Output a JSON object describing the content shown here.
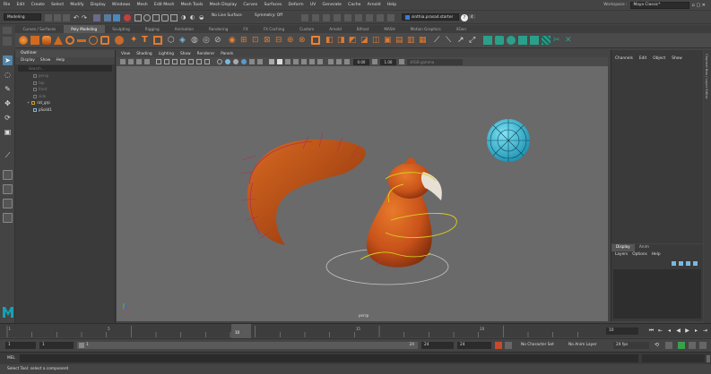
{
  "menubar": {
    "items": [
      "File",
      "Edit",
      "Create",
      "Select",
      "Modify",
      "Display",
      "Windows",
      "Mesh",
      "Edit Mesh",
      "Mesh Tools",
      "Mesh Display",
      "Curves",
      "Surfaces",
      "Deform",
      "UV",
      "Generate",
      "Cache",
      "Arnold",
      "Help"
    ],
    "workspace_label": "Workspace :",
    "workspace_value": "Maya Classic*"
  },
  "statusline": {
    "mode_menu": "Modeling",
    "live_surface": "No Live Surface",
    "symmetry": "Symmetry: Off",
    "user": "sinthia.prasad.starter",
    "user_badge": "4"
  },
  "shelf": {
    "tabs": [
      "Curves / Surfaces",
      "Poly Modeling",
      "Sculpting",
      "Rigging",
      "Animation",
      "Rendering",
      "FX",
      "FX Caching",
      "Custom",
      "Arnold",
      "Bifrost",
      "MASH",
      "Motion Graphics",
      "XGen"
    ],
    "active_tab": "Poly Modeling"
  },
  "outliner": {
    "title": "Outliner",
    "menu": [
      "Display",
      "Show",
      "Help"
    ],
    "search_placeholder": "Search...",
    "hidden_items": [
      "persp",
      "top",
      "front",
      "side"
    ],
    "items": [
      "rat_grp",
      "pSolid1"
    ]
  },
  "viewport": {
    "panel_menu": [
      "View",
      "Shading",
      "Lighting",
      "Show",
      "Renderer",
      "Panels"
    ],
    "field_a": "0.00",
    "field_b": "1.00",
    "colorspace": "sRGB gamma",
    "camera_label": "persp"
  },
  "channelbox": {
    "menu": [
      "Channels",
      "Edit",
      "Object",
      "Show"
    ],
    "sidetab_label": "Channel Box / Layer Editor"
  },
  "layerpanel": {
    "tabs": [
      "Display",
      "Anim"
    ],
    "active_tab": "Display",
    "menu": [
      "Layers",
      "Options",
      "Help"
    ]
  },
  "timeslider": {
    "tick_labels": [
      "1",
      "5",
      "10",
      "15",
      "20"
    ],
    "current_frame": "10",
    "current_field": "10"
  },
  "rangeslider": {
    "start": "1",
    "range_start": "1",
    "range_box": "1",
    "range_end": "24",
    "end_a": "24",
    "end_b": "24",
    "char_set": "No Character Set",
    "anim_layer": "No Anim Layer",
    "fps": "24 fps"
  },
  "cmdline": {
    "lang": "MEL"
  },
  "helpline": {
    "text": "Select Tool: select a component"
  },
  "colors": {
    "viewport_bg": "#6a6a6a",
    "squirrel": "#c8521a",
    "ball": "#2ab0d0",
    "selection_red": "#b03050",
    "curve_yellow": "#d8d020",
    "maya_logo": "#14a3b3"
  }
}
